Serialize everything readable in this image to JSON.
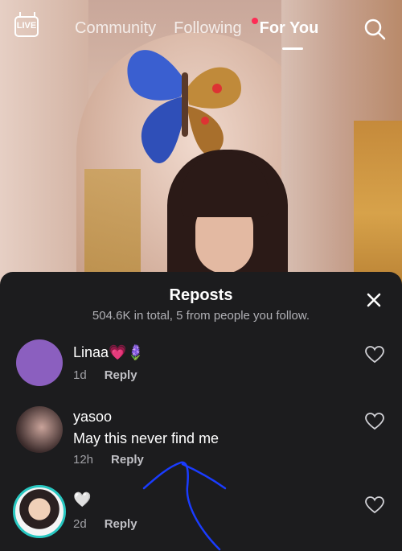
{
  "topnav": {
    "live_label": "LIVE",
    "tabs": [
      {
        "label": "Community"
      },
      {
        "label": "Following"
      },
      {
        "label": "For You",
        "active": true
      }
    ]
  },
  "sheet": {
    "title": "Reposts",
    "subtitle": "504.6K in total, 5 from people you follow."
  },
  "reposts": [
    {
      "name": "Linaa💗🪻",
      "comment": "",
      "time": "1d",
      "reply_label": "Reply"
    },
    {
      "name": "yasoo",
      "comment": "May this never find me",
      "time": "12h",
      "reply_label": "Reply"
    },
    {
      "name": "🤍",
      "comment": "",
      "time": "2d",
      "reply_label": "Reply"
    }
  ],
  "colors": {
    "accent": "#fe2c55",
    "sheet_bg": "#1c1c1e",
    "avatar_purple": "#8b5fbf",
    "ring_teal": "#28c7c1",
    "annotation_stroke": "#1a3cff"
  },
  "icons": [
    "live-icon",
    "search-icon",
    "close-icon",
    "heart-icon"
  ]
}
